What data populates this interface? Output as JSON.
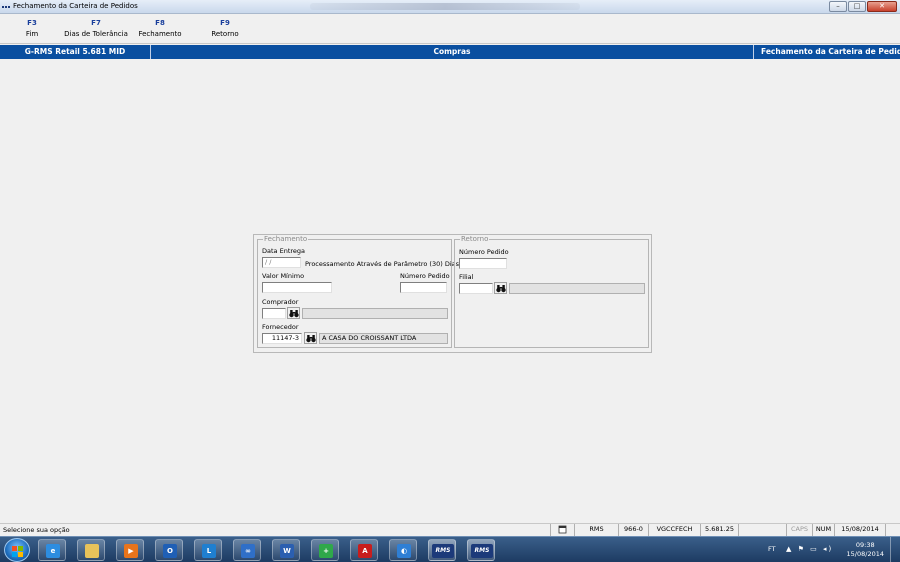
{
  "window": {
    "title": "Fechamento da Carteira de Pedidos",
    "buttons": {
      "minimize": "–",
      "maximize": "□",
      "close": "✕"
    }
  },
  "toolbar": {
    "keys": [
      {
        "key": "F3",
        "label": "Fim"
      },
      {
        "key": "F7",
        "label": "Dias de Tolerância"
      },
      {
        "key": "F8",
        "label": "Fechamento"
      },
      {
        "key": "F9",
        "label": "Retorno"
      }
    ]
  },
  "header": {
    "left": "G-RMS Retail 5.681 MID",
    "center": "Compras",
    "right": "Fechamento da Carteira de Pedidos"
  },
  "fechamento": {
    "legend": "Fechamento",
    "data_entrega_label": "Data Entrega",
    "data_entrega_value": " / /",
    "processamento_text": "Processamento Através de Parâmetro (30) Dias",
    "valor_minimo_label": "Valor Mínimo",
    "valor_minimo_value": "",
    "numero_pedido_label": "Número Pedido",
    "numero_pedido_value": "",
    "comprador_label": "Comprador",
    "comprador_code": "",
    "comprador_name": "",
    "fornecedor_label": "Fornecedor",
    "fornecedor_code": "11147-3",
    "fornecedor_name": "A CASA DO CROISSANT LTDA"
  },
  "retorno": {
    "legend": "Retorno",
    "numero_pedido_label": "Número Pedido",
    "numero_pedido_value": "",
    "filial_label": "Filial",
    "filial_code": "",
    "filial_name": ""
  },
  "status": {
    "message": "Selecione sua opção",
    "cells": [
      "RMS",
      "966-0",
      "VGCCFECH",
      "5.681.25",
      "",
      "CAPS",
      "NUM",
      "15/08/2014"
    ]
  },
  "taskbar": {
    "apps": [
      {
        "name": "internet-explorer",
        "glyph": "e",
        "color": "#2d8de0"
      },
      {
        "name": "file-explorer",
        "glyph": "",
        "color": "#e8c25a"
      },
      {
        "name": "media-player",
        "glyph": "▶",
        "color": "#e8741c"
      },
      {
        "name": "outlook",
        "glyph": "O",
        "color": "#1f5fb5"
      },
      {
        "name": "lync",
        "glyph": "L",
        "color": "#1f7fd0"
      },
      {
        "name": "infinity-app",
        "glyph": "∞",
        "color": "#2f6fc8"
      },
      {
        "name": "word",
        "glyph": "W",
        "color": "#2b5fb0"
      },
      {
        "name": "database-tool",
        "glyph": "+",
        "color": "#2fa84a"
      },
      {
        "name": "acrobat",
        "glyph": "A",
        "color": "#c81d1d"
      },
      {
        "name": "network-app",
        "glyph": "◐",
        "color": "#2f7fd5"
      },
      {
        "name": "rms-app-1",
        "glyph": "RMS",
        "color": "#1c3a7a"
      },
      {
        "name": "rms-app-2",
        "glyph": "RMS",
        "color": "#1c3a7a"
      }
    ],
    "tray_lang": "FT",
    "time": "09:38",
    "date": "15/08/2014"
  },
  "colors": {
    "header_blue": "#0a4fa0",
    "fkey_blue": "#1a3f9c",
    "taskbar": "#1d3b62"
  }
}
